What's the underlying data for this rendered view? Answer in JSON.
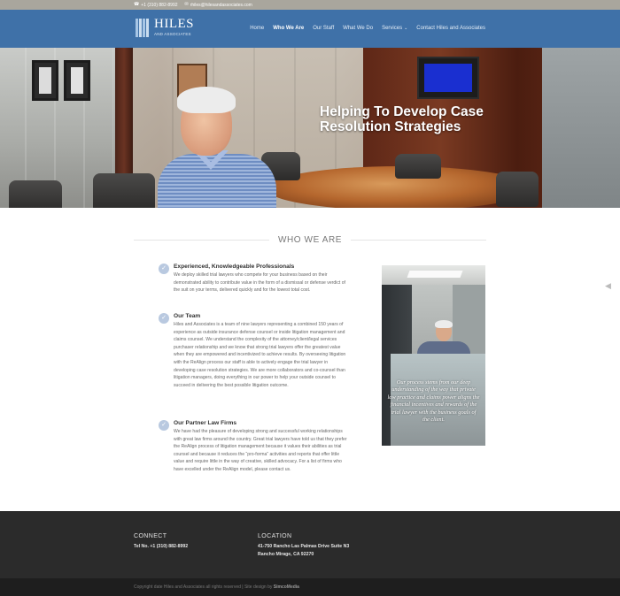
{
  "topbar": {
    "phone": "+1 (310) 882-8992",
    "email": "rhiles@hilesandassociates.com"
  },
  "header": {
    "logo_name": "HILES",
    "logo_sub": "AND ASSOCIATES",
    "nav": [
      {
        "label": "Home"
      },
      {
        "label": "Who We Are"
      },
      {
        "label": "Our Staff"
      },
      {
        "label": "What We Do"
      },
      {
        "label": "Services"
      },
      {
        "label": "Contact Hiles and Associates"
      }
    ],
    "active": "Who We Are"
  },
  "hero": {
    "title": "Helping To Develop Case Resolution Strategies"
  },
  "section": {
    "title": "WHO WE ARE"
  },
  "features": [
    {
      "title": "Experienced, Knowledgeable Professionals",
      "text": "We deploy skilled trial lawyers who compete for your business based on their demonstrated ability to contribute value in the form of a dismissal or defense verdict of the suit on your terms, delivered quickly and for the lowest total cost."
    },
    {
      "title": "Our Team",
      "text": "Hiles and Associates is a team of nine lawyers representing a combined 150 years of experience as outside insurance defense counsel or inside litigation management and claims counsel. We understand the complexity of the attorney/client/legal services purchaser relationship and we know that strong trial lawyers offer the greatest value when they are empowered and incentivized to achieve results. By overseeing litigation with the ReAlign process our staff is able to actively engage the trial lawyer in developing case resolution strategies. We are more collaborators and co-counsel than litigation managers, doing everything in our power to help your outside counsel to succeed in delivering the best possible litigation outcome."
    },
    {
      "title": "Our Partner Law Firms",
      "text": "We have had the pleasure of developing strong and successful working relationships with great law firms around the country. Great trial lawyers have told us that they prefer the ReAlign process of litigation management because it values their abilities as trial counsel and because it reduces the “pro-forma” activities and reports that offer little value and require little in the way of creative, skilled advocacy. For a list of firms who have excelled under the ReAlign model, please contact us."
    }
  ],
  "side_quote": "Our process stems from our deep understanding of the way that private law practice and claims power aligns the financial incentives and rewards of the trial lawyer with the business goals of the client.",
  "footer": {
    "connect_title": "CONNECT",
    "connect_text": "Tel No. +1 (310) 882-8992",
    "location_title": "LOCATION",
    "address_line1": "41-750 Rancho Las Palmas Drive Suite N3",
    "address_line2": "Rancho Mirage, CA 92270",
    "copyright": "Copyright date Hiles and Associates all rights reserved | Site design by",
    "designer": "SimcoMedia"
  }
}
